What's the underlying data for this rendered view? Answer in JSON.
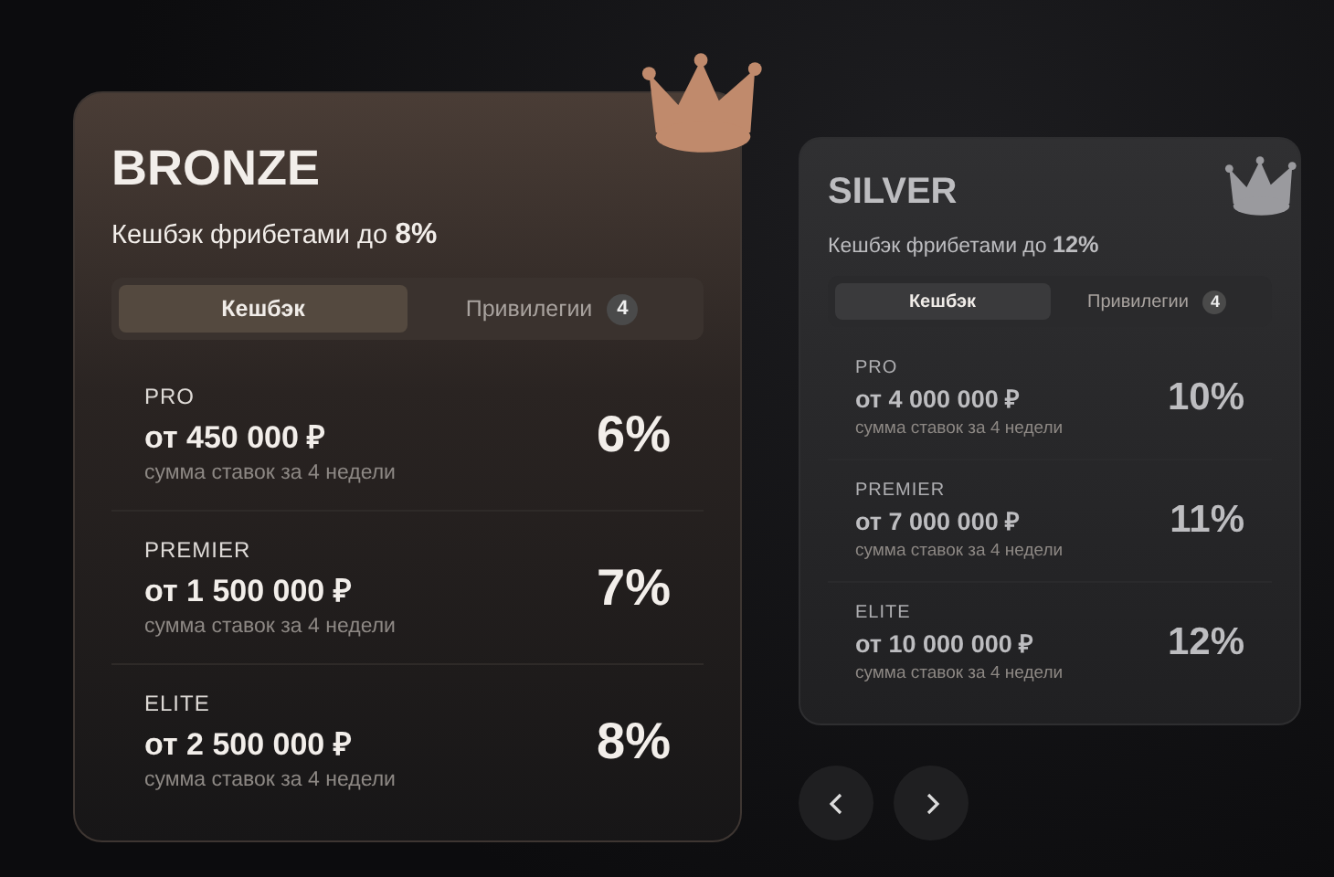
{
  "cards": [
    {
      "tier": "BRONZE",
      "selected": true,
      "color": "#c08a6c",
      "headline": "Кешбэк фрибетами до **8%**",
      "tabs": [
        {
          "label": "Кешбэк",
          "selected": true
        },
        {
          "label": "Привилегии",
          "badge": "4",
          "selected": false
        }
      ],
      "levels": [
        {
          "name": "PRO",
          "amount": "от 450 000 ₽",
          "note": "сумма ставок за 4 недели",
          "percent": "6%"
        },
        {
          "name": "PREMIER",
          "amount": "от 1 500 000 ₽",
          "note": "сумма ставок за 4 недели",
          "percent": "7%"
        },
        {
          "name": "ELITE",
          "amount": "от 2 500 000 ₽",
          "note": "сумма ставок за 4 недели",
          "percent": "8%"
        }
      ]
    },
    {
      "tier": "SILVER",
      "selected": false,
      "color": "#9a9a9e",
      "headline": "Кешбэк фрибетами до **12%**",
      "tabs": [
        {
          "label": "Кешбэк",
          "selected": true
        },
        {
          "label": "Привилегии",
          "badge": "4",
          "selected": false
        }
      ],
      "levels": [
        {
          "name": "PRO",
          "amount": "от 4 000 000 ₽",
          "note": "сумма ставок за 4 недели",
          "percent": "10%"
        },
        {
          "name": "PREMIER",
          "amount": "от 7 000 000 ₽",
          "note": "сумма ставок за 4 недели",
          "percent": "11%"
        },
        {
          "name": "ELITE",
          "amount": "от 10 000 000 ₽",
          "note": "сумма ставок за 4 недели",
          "percent": "12%"
        }
      ]
    }
  ]
}
